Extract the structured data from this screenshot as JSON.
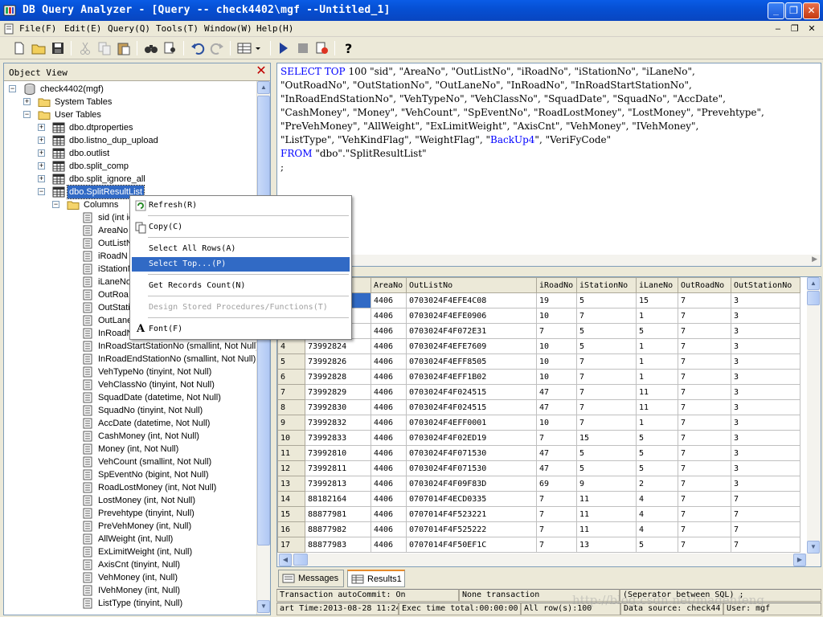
{
  "window": {
    "title": "DB Query Analyzer - [Query -- check4402\\mgf  --Untitled_1]"
  },
  "menu": {
    "items": [
      "File(F)",
      "Edit(E)",
      "Query(Q)",
      "Tools(T)",
      "Window(W)",
      "Help(H)"
    ]
  },
  "object_view": {
    "title": "Object View",
    "tree": [
      {
        "label": "check4402(mgf)",
        "level": 0,
        "expander": "-",
        "icon": "database-icon"
      },
      {
        "label": "System Tables",
        "level": 1,
        "expander": "+",
        "icon": "folder-icon"
      },
      {
        "label": "User Tables",
        "level": 1,
        "expander": "-",
        "icon": "folder-icon"
      },
      {
        "label": "dbo.dtproperties",
        "level": 2,
        "expander": "+",
        "icon": "table-icon"
      },
      {
        "label": "dbo.listno_dup_upload",
        "level": 2,
        "expander": "+",
        "icon": "table-icon"
      },
      {
        "label": "dbo.outlist",
        "level": 2,
        "expander": "+",
        "icon": "table-icon"
      },
      {
        "label": "dbo.split_comp",
        "level": 2,
        "expander": "+",
        "icon": "table-icon"
      },
      {
        "label": "dbo.split_ignore_all",
        "level": 2,
        "expander": "+",
        "icon": "table-icon"
      },
      {
        "label": "dbo.SplitResultList",
        "level": 2,
        "expander": "-",
        "icon": "table-icon",
        "selected": true
      },
      {
        "label": "Columns",
        "level": 3,
        "expander": "-",
        "icon": "folder-icon"
      },
      {
        "label": "sid (int id",
        "level": 4,
        "icon": "column-icon"
      },
      {
        "label": "AreaNo",
        "level": 4,
        "icon": "column-icon"
      },
      {
        "label": "OutListN",
        "level": 4,
        "icon": "column-icon"
      },
      {
        "label": "iRoadN",
        "level": 4,
        "icon": "column-icon"
      },
      {
        "label": "iStationN",
        "level": 4,
        "icon": "column-icon"
      },
      {
        "label": "iLaneNo",
        "level": 4,
        "icon": "column-icon"
      },
      {
        "label": "OutRoa",
        "level": 4,
        "icon": "column-icon"
      },
      {
        "label": "OutStati",
        "level": 4,
        "icon": "column-icon"
      },
      {
        "label": "OutLane",
        "level": 4,
        "icon": "column-icon"
      },
      {
        "label": "InRoadN",
        "level": 4,
        "icon": "column-icon"
      },
      {
        "label": "InRoadStartStationNo (smallint, Not Null)",
        "level": 4,
        "icon": "column-icon"
      },
      {
        "label": "InRoadEndStationNo (smallint, Not Null)",
        "level": 4,
        "icon": "column-icon"
      },
      {
        "label": "VehTypeNo (tinyint, Not Null)",
        "level": 4,
        "icon": "column-icon"
      },
      {
        "label": "VehClassNo (tinyint, Not Null)",
        "level": 4,
        "icon": "column-icon"
      },
      {
        "label": "SquadDate (datetime, Not Null)",
        "level": 4,
        "icon": "column-icon"
      },
      {
        "label": "SquadNo (tinyint, Not Null)",
        "level": 4,
        "icon": "column-icon"
      },
      {
        "label": "AccDate (datetime, Not Null)",
        "level": 4,
        "icon": "column-icon"
      },
      {
        "label": "CashMoney (int, Not Null)",
        "level": 4,
        "icon": "column-icon"
      },
      {
        "label": "Money (int, Not Null)",
        "level": 4,
        "icon": "column-icon"
      },
      {
        "label": "VehCount (smallint, Not Null)",
        "level": 4,
        "icon": "column-icon"
      },
      {
        "label": "SpEventNo (bigint, Not Null)",
        "level": 4,
        "icon": "column-icon"
      },
      {
        "label": "RoadLostMoney (int, Not Null)",
        "level": 4,
        "icon": "column-icon"
      },
      {
        "label": "LostMoney (int, Not Null)",
        "level": 4,
        "icon": "column-icon"
      },
      {
        "label": "Prevehtype (tinyint, Null)",
        "level": 4,
        "icon": "column-icon"
      },
      {
        "label": "PreVehMoney (int, Null)",
        "level": 4,
        "icon": "column-icon"
      },
      {
        "label": "AllWeight (int, Null)",
        "level": 4,
        "icon": "column-icon"
      },
      {
        "label": "ExLimitWeight (int, Null)",
        "level": 4,
        "icon": "column-icon"
      },
      {
        "label": "AxisCnt (tinyint, Null)",
        "level": 4,
        "icon": "column-icon"
      },
      {
        "label": "VehMoney (int, Null)",
        "level": 4,
        "icon": "column-icon"
      },
      {
        "label": "IVehMoney (int, Null)",
        "level": 4,
        "icon": "column-icon"
      },
      {
        "label": "ListType (tinyint, Null)",
        "level": 4,
        "icon": "column-icon"
      }
    ]
  },
  "context_menu": {
    "refresh": "Refresh(R)",
    "copy": "Copy(C)",
    "select_all_rows": "Select All Rows(A)",
    "select_top": "Select Top...(P)",
    "get_records_count": "Get Records Count(N)",
    "design_procs": "Design Stored Procedures/Functions(T)",
    "font": "Font(F)"
  },
  "editor": {
    "lines": [
      [
        {
          "t": "SELECT  TOP",
          "k": true
        },
        {
          "t": " 100    \"sid\", \"AreaNo\", \"OutListNo\", \"iRoadNo\", \"iStationNo\", \"iLaneNo\","
        }
      ],
      [
        {
          "t": "\"OutRoadNo\", \"OutStationNo\", \"OutLaneNo\", \"InRoadNo\", \"InRoadStartStationNo\","
        }
      ],
      [
        {
          "t": "\"InRoadEndStationNo\", \"VehTypeNo\", \"VehClassNo\", \"SquadDate\", \"SquadNo\", \"AccDate\","
        }
      ],
      [
        {
          "t": "\"CashMoney\", \"Money\", \"VehCount\", \"SpEventNo\", \"RoadLostMoney\", \"LostMoney\", \"Prevehtype\","
        }
      ],
      [
        {
          "t": " \"PreVehMoney\", \"AllWeight\", \"ExLimitWeight\", \"AxisCnt\", \"VehMoney\", \"IVehMoney\","
        }
      ],
      [
        {
          "t": " \"ListType\", \"VehKindFlag\", \"WeightFlag\", \""
        },
        {
          "t": "BackUp4",
          "k": true
        },
        {
          "t": "\", \"VeriFyCode\""
        }
      ],
      [
        {
          "t": "FROM",
          "k": true
        },
        {
          "t": "  \"dbo\".\"SplitResultList\""
        }
      ],
      [
        {
          "t": ";"
        }
      ]
    ]
  },
  "results": {
    "columns": [
      "",
      "",
      "AreaNo",
      "OutListNo",
      "iRoadNo",
      "iStationNo",
      "iLaneNo",
      "OutRoadNo",
      "OutStationNo"
    ],
    "rows": [
      [
        "",
        "",
        "4406",
        "0703024F4EFE4C08",
        "19",
        "5",
        "15",
        "7",
        "3"
      ],
      [
        "",
        "",
        "4406",
        "0703024F4EFE0906",
        "10",
        "7",
        "1",
        "7",
        "3"
      ],
      [
        "",
        "",
        "4406",
        "0703024F4F072E31",
        "7",
        "5",
        "5",
        "7",
        "3"
      ],
      [
        "4",
        "73992824",
        "4406",
        "0703024F4EFE7609",
        "10",
        "5",
        "1",
        "7",
        "3"
      ],
      [
        "5",
        "73992826",
        "4406",
        "0703024F4EFF8505",
        "10",
        "7",
        "1",
        "7",
        "3"
      ],
      [
        "6",
        "73992828",
        "4406",
        "0703024F4EFF1B02",
        "10",
        "7",
        "1",
        "7",
        "3"
      ],
      [
        "7",
        "73992829",
        "4406",
        "0703024F4F024515",
        "47",
        "7",
        "11",
        "7",
        "3"
      ],
      [
        "8",
        "73992830",
        "4406",
        "0703024F4F024515",
        "47",
        "7",
        "11",
        "7",
        "3"
      ],
      [
        "9",
        "73992832",
        "4406",
        "0703024F4EFF0001",
        "10",
        "7",
        "1",
        "7",
        "3"
      ],
      [
        "10",
        "73992833",
        "4406",
        "0703024F4F02ED19",
        "7",
        "15",
        "5",
        "7",
        "3"
      ],
      [
        "11",
        "73992810",
        "4406",
        "0703024F4F071530",
        "47",
        "5",
        "5",
        "7",
        "3"
      ],
      [
        "12",
        "73992811",
        "4406",
        "0703024F4F071530",
        "47",
        "5",
        "5",
        "7",
        "3"
      ],
      [
        "13",
        "73992813",
        "4406",
        "0703024F4F09F83D",
        "69",
        "9",
        "2",
        "7",
        "3"
      ],
      [
        "14",
        "88182164",
        "4406",
        "0707014F4ECD0335",
        "7",
        "11",
        "4",
        "7",
        "7"
      ],
      [
        "15",
        "88877981",
        "4406",
        "0707014F4F523221",
        "7",
        "11",
        "4",
        "7",
        "7"
      ],
      [
        "16",
        "88877982",
        "4406",
        "0707014F4F525222",
        "7",
        "11",
        "4",
        "7",
        "7"
      ],
      [
        "17",
        "88877983",
        "4406",
        "0707014F4F50EF1C",
        "7",
        "13",
        "5",
        "7",
        "7"
      ]
    ]
  },
  "tabs": {
    "messages": "Messages",
    "results": "Results1"
  },
  "status": {
    "autocommit": "Transaction autoCommit: On",
    "transaction": "None transaction",
    "separator": "(Seperator between SQL)  ;",
    "start_time": "art Time:2013-08-28 11:24",
    "exec_time": "Exec time total:00:00:00",
    "rows": "All row(s):100",
    "data_source": "Data source: check44",
    "user": "User: mgf"
  },
  "watermark": "http://blog.csdn.net/magenfeng"
}
